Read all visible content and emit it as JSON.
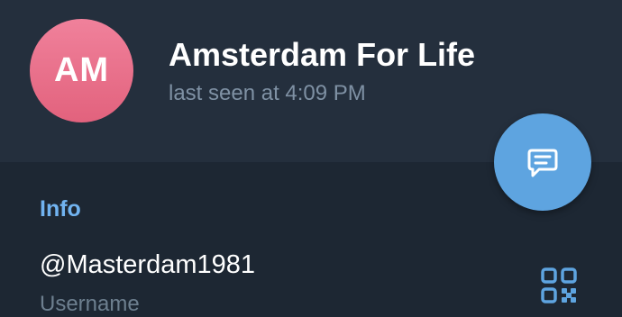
{
  "profile": {
    "avatar_initials": "AM",
    "name": "Amsterdam For Life",
    "status": "last seen at 4:09 PM"
  },
  "info": {
    "section_title": "Info",
    "username_value": "@Masterdam1981",
    "username_label": "Username"
  },
  "icons": {
    "fab": "message-icon",
    "qr": "qr-code-icon"
  },
  "colors": {
    "header_bg": "#242f3d",
    "body_bg": "#1d2733",
    "accent": "#5ea4e0",
    "section_title": "#71b3f0",
    "avatar_bg": "#e8708b",
    "secondary_text": "#7f91a4"
  }
}
